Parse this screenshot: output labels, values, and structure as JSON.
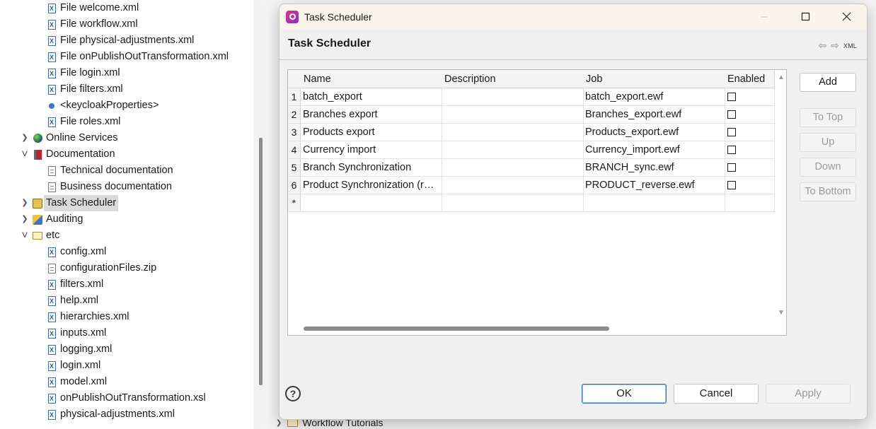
{
  "tree": {
    "items": [
      {
        "label": "File welcome.xml",
        "icon": "xml-file-icon"
      },
      {
        "label": "File workflow.xml",
        "icon": "xml-file-icon"
      },
      {
        "label": "File physical-adjustments.xml",
        "icon": "xml-file-icon"
      },
      {
        "label": "File onPublishOutTransformation.xml",
        "icon": "xml-file-icon"
      },
      {
        "label": "File login.xml",
        "icon": "xml-file-icon"
      },
      {
        "label": "File filters.xml",
        "icon": "xml-file-icon"
      },
      {
        "label": "<keycloakProperties>",
        "icon": "property-dot-icon"
      },
      {
        "label": "File roles.xml",
        "icon": "xml-file-icon"
      },
      {
        "label": "Online Services",
        "icon": "globe-icon"
      },
      {
        "label": "Documentation",
        "icon": "book-icon"
      },
      {
        "label": "Technical documentation",
        "icon": "document-icon"
      },
      {
        "label": "Business documentation",
        "icon": "document-icon"
      },
      {
        "label": "Task Scheduler",
        "icon": "scheduler-icon"
      },
      {
        "label": "Auditing",
        "icon": "auditing-icon"
      },
      {
        "label": "etc",
        "icon": "folder-icon"
      },
      {
        "label": "config.xml",
        "icon": "xml-file-icon"
      },
      {
        "label": "configurationFiles.zip",
        "icon": "document-icon"
      },
      {
        "label": "filters.xml",
        "icon": "xml-file-icon"
      },
      {
        "label": "help.xml",
        "icon": "xml-file-icon"
      },
      {
        "label": "hierarchies.xml",
        "icon": "xml-file-icon"
      },
      {
        "label": "inputs.xml",
        "icon": "xml-file-icon"
      },
      {
        "label": "logging.xml",
        "icon": "xml-file-icon"
      },
      {
        "label": "login.xml",
        "icon": "xml-file-icon"
      },
      {
        "label": "model.xml",
        "icon": "xml-file-icon"
      },
      {
        "label": "onPublishOutTransformation.xsl",
        "icon": "xml-file-icon"
      },
      {
        "label": "physical-adjustments.xml",
        "icon": "xml-file-icon"
      }
    ]
  },
  "background": {
    "workflow_tutorials": "Workflow Tutorials"
  },
  "dialog": {
    "window_title": "Task Scheduler",
    "page_title": "Task Scheduler",
    "xml_label": "XML",
    "grid": {
      "columns": [
        "Name",
        "Description",
        "Job",
        "Enabled"
      ],
      "rows": [
        {
          "num": "1",
          "name": "batch_export",
          "description": "",
          "job": "batch_export.ewf",
          "enabled": false
        },
        {
          "num": "2",
          "name": "Branches export",
          "description": "",
          "job": "Branches_export.ewf",
          "enabled": false
        },
        {
          "num": "3",
          "name": "Products export",
          "description": "",
          "job": "Products_export.ewf",
          "enabled": false
        },
        {
          "num": "4",
          "name": "Currency import",
          "description": "",
          "job": "Currency_import.ewf",
          "enabled": false
        },
        {
          "num": "5",
          "name": "Branch Synchronization",
          "description": "",
          "job": "BRANCH_sync.ewf",
          "enabled": false
        },
        {
          "num": "6",
          "name": "Product Synchronization (r…",
          "description": "",
          "job": "PRODUCT_reverse.ewf",
          "enabled": false
        }
      ],
      "new_row_marker": "*"
    },
    "side_buttons": {
      "add": "Add",
      "to_top": "To Top",
      "up": "Up",
      "down": "Down",
      "to_bottom": "To Bottom"
    },
    "footer": {
      "help": "?",
      "ok": "OK",
      "cancel": "Cancel",
      "apply": "Apply"
    }
  }
}
